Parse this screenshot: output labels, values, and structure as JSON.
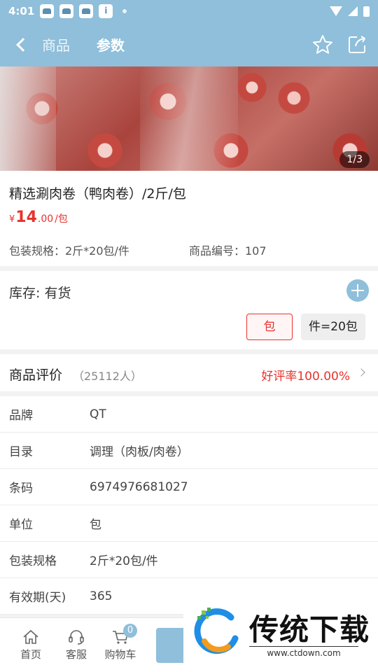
{
  "status_bar": {
    "time": "4:01"
  },
  "nav": {
    "tabs": [
      "商品",
      "参数"
    ]
  },
  "hero": {
    "counter": "1/3"
  },
  "product": {
    "title": "精选涮肉卷（鸭肉卷）/2斤/包",
    "price_currency": "¥",
    "price_int": "14",
    "price_dec": ".00",
    "price_unit": "/包",
    "spec_label": "包装规格：2斤*20包/件",
    "code_label": "商品编号：107"
  },
  "stock": {
    "label": "库存: 有货",
    "units": [
      "包",
      "件=20包"
    ]
  },
  "review": {
    "title": "商品评价",
    "count": "（25112人）",
    "rate": "好评率100.00%"
  },
  "params": [
    {
      "key": "品牌",
      "value": "QT"
    },
    {
      "key": "目录",
      "value": "调理（肉板/肉卷）"
    },
    {
      "key": "条码",
      "value": "6974976681027"
    },
    {
      "key": "单位",
      "value": "包"
    },
    {
      "key": "包装规格",
      "value": "2斤*20包/件"
    },
    {
      "key": "有效期(天)",
      "value": "365"
    }
  ],
  "bottom_bar": {
    "home": "首页",
    "service": "客服",
    "cart": "购物车",
    "cart_badge": "0"
  },
  "watermark": {
    "title": "传统下载",
    "url": "www.ctdown.com"
  },
  "colors": {
    "accent": "#8fbfda",
    "price": "#e8322c"
  }
}
